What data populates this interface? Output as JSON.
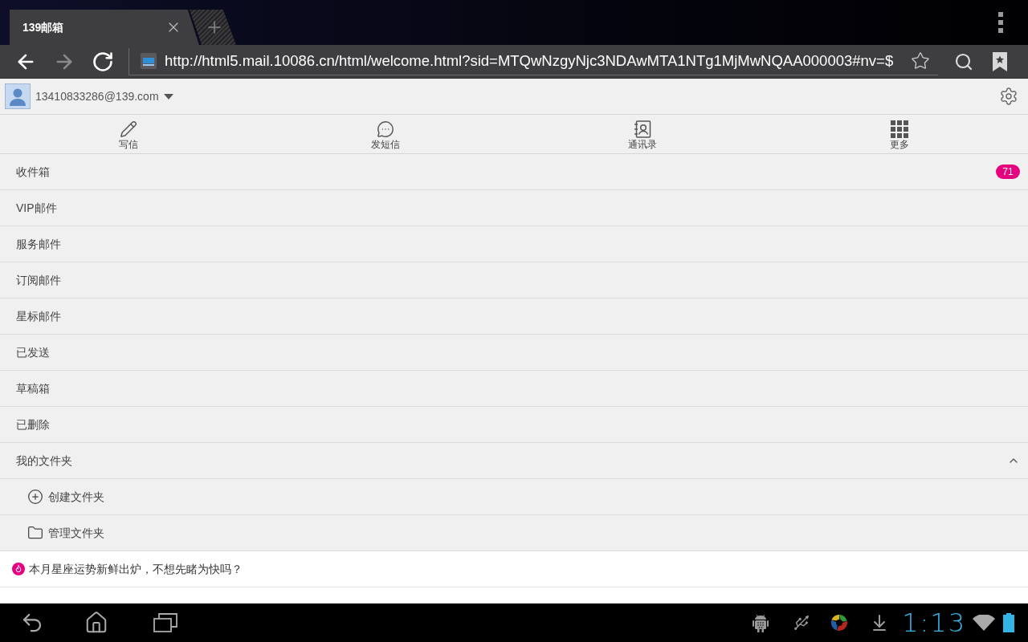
{
  "browser": {
    "tabs": [
      {
        "title": "139邮箱",
        "selected": true
      }
    ],
    "nav_buttons": [
      {
        "kind": "back",
        "disabled": false
      },
      {
        "kind": "forward",
        "disabled": true
      },
      {
        "kind": "reload",
        "disabled": false
      }
    ],
    "url": "http://html5.mail.10086.cn/html/welcome.html?sid=MTQwNzgyNjc3NDAwMTA1NTg1MjMwNQAA000003#nv=$"
  },
  "account": {
    "email": "13410833286@139.com"
  },
  "toolbar": [
    {
      "kind": "compose",
      "label": "写信"
    },
    {
      "kind": "sms",
      "label": "发短信"
    },
    {
      "kind": "contacts",
      "label": "通讯录"
    },
    {
      "kind": "more",
      "label": "更多"
    }
  ],
  "folders": [
    {
      "label": "收件箱",
      "count": "71"
    },
    {
      "label": "VIP邮件"
    },
    {
      "label": "服务邮件"
    },
    {
      "label": "订阅邮件"
    },
    {
      "label": "星标邮件"
    },
    {
      "label": "已发送"
    },
    {
      "label": "草稿箱"
    },
    {
      "label": "已删除"
    }
  ],
  "my_folders": {
    "label": "我的文件夹",
    "expanded": true,
    "children": [
      {
        "kind": "create",
        "label": "创建文件夹"
      },
      {
        "kind": "manage",
        "label": "管理文件夹"
      }
    ]
  },
  "promos": [
    {
      "text": "本月星座运势新鲜出炉，不想先睹为快吗？"
    }
  ],
  "status_bar": {
    "time": "1:13"
  }
}
